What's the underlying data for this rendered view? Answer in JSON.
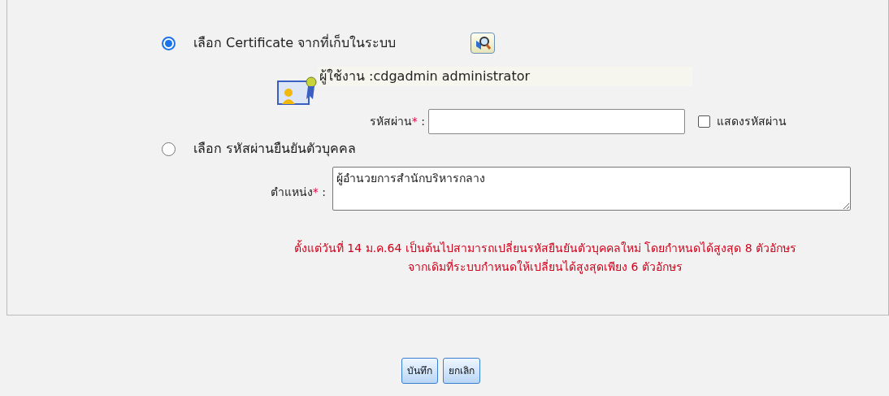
{
  "options": [
    {
      "label": "เลือก Certificate จากที่เก็บในระบบ",
      "selected": true
    },
    {
      "label": "เลือก รหัสผ่านยืนยันตัวบุคคล",
      "selected": false
    }
  ],
  "user": "ผู้ใช้งาน :cdgadmin administrator",
  "password": {
    "label": "รหัสผ่าน",
    "required_mark": "*",
    "colon": ":",
    "show_password": {
      "label": "แสดงรหัสผ่าน",
      "checked": false
    }
  },
  "position": {
    "label": "ตำแหน่ง",
    "required_mark": "*",
    "colon": ":",
    "value": "ผู้อำนวยการสำนักบริหารกลาง"
  },
  "notice": [
    "ตั้งแต่วันที่ 14 ม.ค.64 เป็นต้นไปสามารถเปลี่ยนรหัสยืนยันตัวบุคคลใหม่ โดยกำหนดได้สูงสุด 8 ตัวอักษร",
    "จากเดิมที่ระบบกำหนดให้เปลี่ยนได้สูงสุดเพียง 6 ตัวอักษร"
  ],
  "buttons": [
    "บันทึก",
    "ยกเลิก"
  ]
}
